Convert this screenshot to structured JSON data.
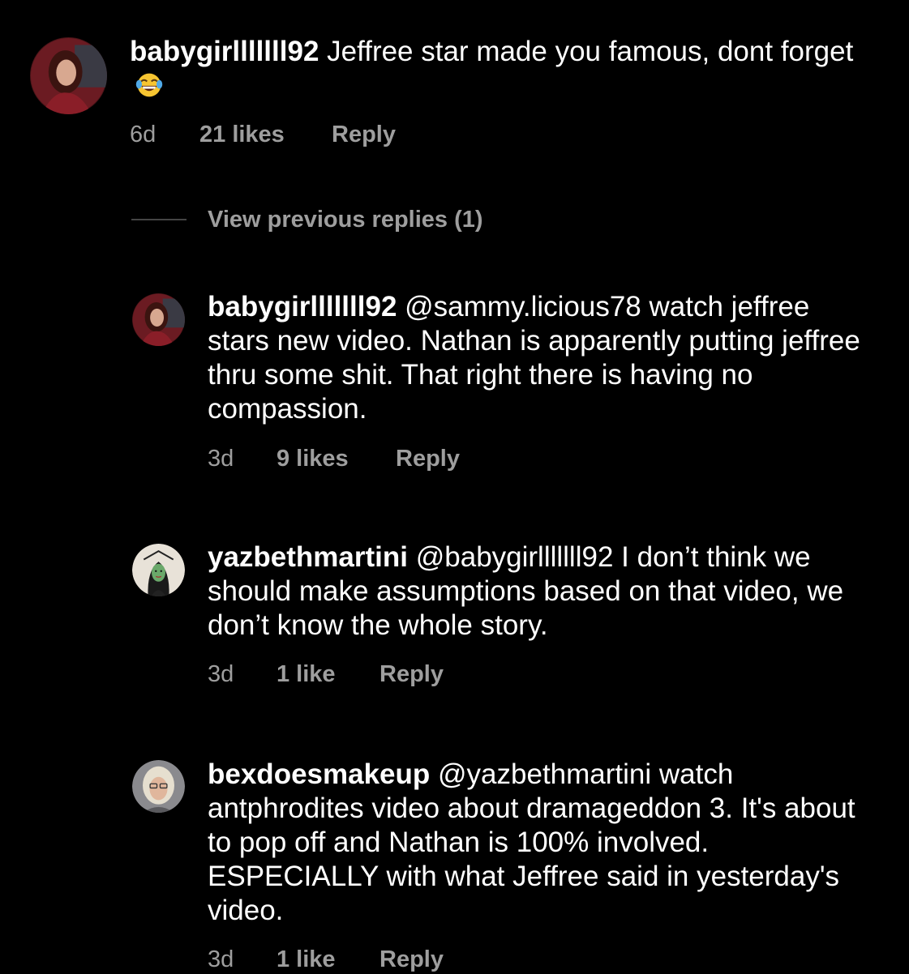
{
  "comments": [
    {
      "username": "babygirlllllll92",
      "text": "Jeffree star made you famous, dont forget",
      "emoji": "face-with-tears-of-joy",
      "age": "6d",
      "likes": "21 likes",
      "reply": "Reply"
    }
  ],
  "thread": {
    "view_previous": "View previous replies (1)",
    "replies": [
      {
        "username": "babygirlllllll92",
        "mention": "@sammy.licious78",
        "text": "watch jeffree stars new video. Nathan is apparently putting jeffree thru some shit. That right there is having no compassion.",
        "age": "3d",
        "likes": "9 likes",
        "reply": "Reply"
      },
      {
        "username": "yazbethmartini",
        "mention": "@babygirlllllll92",
        "text": "I don’t think we should make assumptions based on that video, we don’t know the whole story.",
        "age": "3d",
        "likes": "1 like",
        "reply": "Reply"
      },
      {
        "username": "bexdoesmakeup",
        "mention": "@yazbethmartini",
        "text": "watch antphrodites video about dramageddon 3. It's about to pop off and Nathan is 100% involved. ESPECIALLY with what Jeffree said in yesterday's video.",
        "age": "3d",
        "likes": "1 like",
        "reply": "Reply"
      }
    ]
  },
  "colors": {
    "background": "#000000",
    "text": "#ffffff",
    "muted": "#9e9e9e"
  }
}
